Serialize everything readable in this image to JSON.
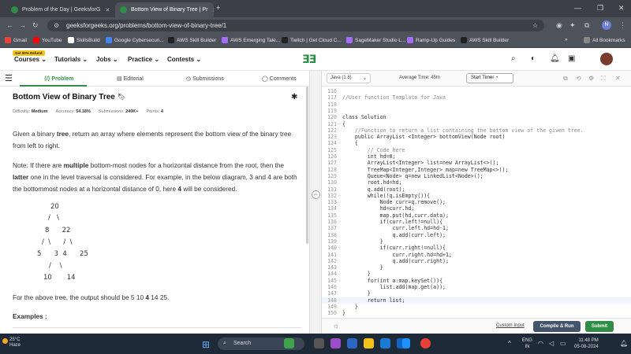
{
  "browser": {
    "tabs": [
      {
        "label": "Problem of the Day | GeeksforG"
      },
      {
        "label": "Bottom View of Binary Tree | Pr"
      }
    ],
    "url": "geeksforgeeks.org/problems/bottom-view-of-binary-tree/1",
    "bookmarks": [
      "Gmail",
      "YouTube",
      "SkillsBuild",
      "Google Cybersecuri...",
      "AWS Skill Builder",
      "AWS Emerging Tale...",
      "Twitch | Get Cloud C...",
      "SageMaker Studio L...",
      "Ramp-Up Guides",
      "AWS Skill Builder",
      "All Bookmarks"
    ]
  },
  "site": {
    "badge": "Get 90% Refund",
    "menu": [
      "Courses",
      "Tutorials",
      "Jobs",
      "Practice",
      "Contests"
    ],
    "logo": "GG"
  },
  "left": {
    "tabs": [
      "Problem",
      "Editorial",
      "Submissions",
      "Comments"
    ],
    "title": "Bottom View of Binary Tree",
    "meta": {
      "difficulty_label": "Difficulty:",
      "difficulty": "Medium",
      "accuracy_label": "Accuracy:",
      "accuracy": "54.18%",
      "submissions_label": "Submissions:",
      "submissions": "240K+",
      "points_label": "Points:",
      "points": "4"
    },
    "p1a": "Given a binary ",
    "p1b": "tree",
    "p1c": ", return an array where elements represent the bottom view of the binary tree from left to right.",
    "p2a": "Note: If there are ",
    "p2b": "multiple",
    "p2c": " bottom-most nodes for a horizontal distance from the root, then the ",
    "p2d": "latter",
    "p2e": " one in the level traversal is considered. For example, in the below diagram, 3 and 4 are both the bottommost nodes at a horizontal distance of 0, here ",
    "p2f": "4",
    "p2g": " will be considered.",
    "tree": [
      "20",
      "/   \\",
      "8      22",
      "/  \\      /  \\",
      "5      3  4      25",
      "/    \\",
      "10       14"
    ],
    "p3a": "For the above tree, the output should be 5 10 ",
    "p3b": "4",
    "p3c": " 14 25.",
    "examples": "Examples :"
  },
  "editor": {
    "language": "Java (1.8)",
    "avg_time": "Average Time: 45m",
    "timer": "Start Timer",
    "lines": [
      {
        "n": "116",
        "t": ""
      },
      {
        "n": "117",
        "t": "//User function Template for Java",
        "c": true
      },
      {
        "n": "118",
        "t": ""
      },
      {
        "n": "119",
        "t": ""
      },
      {
        "n": "120",
        "t": "class Solution"
      },
      {
        "n": "121",
        "t": "{"
      },
      {
        "n": "122",
        "t": "    //Function to return a list containing the bottom view of the given tree.",
        "c": true
      },
      {
        "n": "123",
        "t": "    public ArrayList <Integer> bottomView(Node root)"
      },
      {
        "n": "124",
        "t": "    {"
      },
      {
        "n": "125",
        "t": "        // Code here",
        "c": true
      },
      {
        "n": "126",
        "t": "        int hd=0;"
      },
      {
        "n": "127",
        "t": "        ArrayList<Integer> list=new ArrayList<>();"
      },
      {
        "n": "128",
        "t": "        TreeMap<Integer,Integer> map=new TreeMap<>();"
      },
      {
        "n": "129",
        "t": "        Queue<Node> q=new LinkedList<Node>();"
      },
      {
        "n": "130",
        "t": "        root.hd=hd;"
      },
      {
        "n": "131",
        "t": "        q.add(root);"
      },
      {
        "n": "132",
        "t": "        while(!q.isEmpty()){"
      },
      {
        "n": "133",
        "t": "            Node curr=q.remove();"
      },
      {
        "n": "134",
        "t": "            hd=curr.hd;"
      },
      {
        "n": "135",
        "t": "            map.put(hd,curr.data);"
      },
      {
        "n": "136",
        "t": "            if(curr.left!=null){"
      },
      {
        "n": "137",
        "t": "                curr.left.hd=hd-1;"
      },
      {
        "n": "138",
        "t": "                q.add(curr.left);"
      },
      {
        "n": "139",
        "t": "            }"
      },
      {
        "n": "140",
        "t": "            if(curr.right!=null){"
      },
      {
        "n": "141",
        "t": "                curr.right.hd=hd+1;"
      },
      {
        "n": "142",
        "t": "                q.add(curr.right);"
      },
      {
        "n": "143",
        "t": "            }"
      },
      {
        "n": "144",
        "t": "        }"
      },
      {
        "n": "145",
        "t": "        for(int a:map.keySet()){"
      },
      {
        "n": "146",
        "t": "            list.add(map.get(a));"
      },
      {
        "n": "147",
        "t": "        }"
      },
      {
        "n": "148",
        "t": "        return list;"
      },
      {
        "n": "149",
        "t": "    }"
      },
      {
        "n": "150",
        "t": "}"
      }
    ],
    "custom_input": "Custom Input",
    "compile": "Compile & Run",
    "submit": "Submit"
  },
  "taskbar": {
    "temp": "25°C",
    "weather": "Haze",
    "search": "Search",
    "lang1": "ENG",
    "lang2": "IN",
    "time": "11:48 PM",
    "date": "05-08-2024"
  }
}
